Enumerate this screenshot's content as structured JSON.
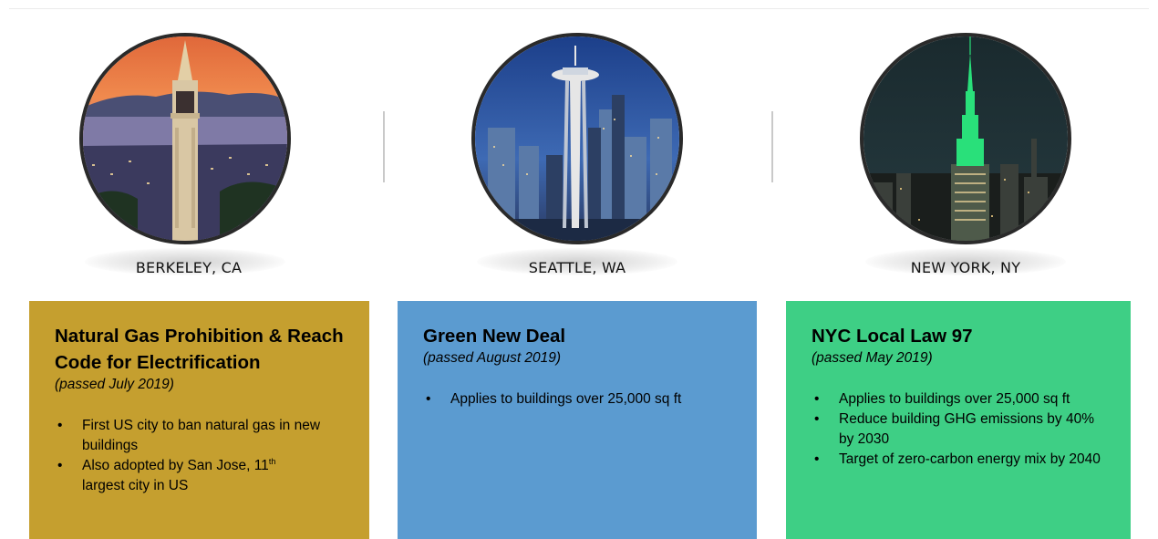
{
  "cities": [
    {
      "label": "BERKELEY, CA",
      "card": {
        "title": "Natural Gas Prohibition & Reach Code for Electrification",
        "date": "(passed July 2019)",
        "bullets": [
          "First US city to ban natural gas in new buildings",
          "Also adopted by San Jose, 11",
          "largest city in US"
        ],
        "bullet_sup": "th",
        "color": "#c59f2f"
      }
    },
    {
      "label": "SEATTLE, WA",
      "card": {
        "title": "Green New Deal",
        "date": "(passed August 2019)",
        "bullets": [
          "Applies to buildings over 25,000 sq ft"
        ],
        "color": "#5b9bd0"
      }
    },
    {
      "label": "NEW YORK, NY",
      "card": {
        "title": "NYC Local Law 97",
        "date": "(passed May 2019)",
        "bullets": [
          "Applies to buildings over 25,000 sq ft",
          "Reduce building GHG emissions by 40% by 2030",
          "Target of zero-carbon energy mix by 2040"
        ],
        "color": "#3ecf85"
      }
    }
  ],
  "bullet_symbol": "•"
}
